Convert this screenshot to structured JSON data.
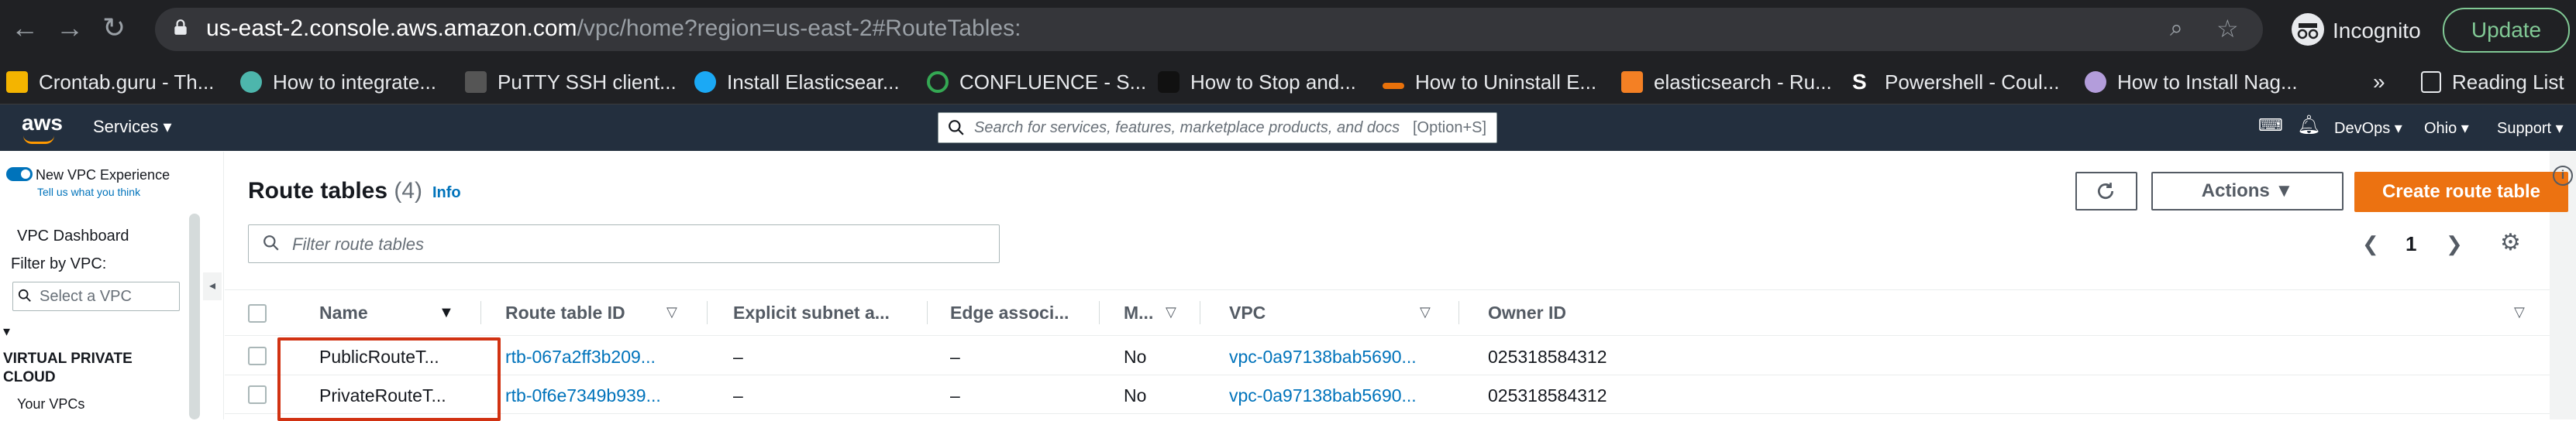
{
  "browser": {
    "url_host": "us-east-2.console.aws.amazon.com",
    "url_path": "/vpc/home?region=us-east-2#RouteTables:",
    "incognito_label": "Incognito",
    "update_label": "Update",
    "reading_list_label": "Reading List",
    "overflow_label": "»",
    "bookmarks": [
      {
        "label": "Crontab.guru - Th...",
        "color": "#f4b400"
      },
      {
        "label": "How to integrate...",
        "color": "#4db6ac"
      },
      {
        "label": "PuTTY SSH client...",
        "color": "#555555"
      },
      {
        "label": "Install Elasticsear...",
        "color": "#1ba9f5"
      },
      {
        "label": "CONFLUENCE - S...",
        "color": "#34a853"
      },
      {
        "label": "How to Stop and...",
        "color": "#333333"
      },
      {
        "label": "How to Uninstall E...",
        "color": "#e8710a"
      },
      {
        "label": "elasticsearch - Ru...",
        "color": "#f48024"
      },
      {
        "label": "Powershell - Coul...",
        "color": "#ffffff"
      },
      {
        "label": "How to Install Nag...",
        "color": "#b39ddb"
      }
    ]
  },
  "aws": {
    "logo": "aws",
    "services_label": "Services",
    "search_placeholder": "Search for services, features, marketplace products, and docs",
    "search_shortcut": "[Option+S]",
    "account_label": "DevOps",
    "region_label": "Ohio",
    "support_label": "Support"
  },
  "sidebar": {
    "new_experience_label": "New VPC Experience",
    "tell_us_label": "Tell us what you think",
    "dashboard_label": "VPC Dashboard",
    "filter_label": "Filter by VPC:",
    "select_placeholder": "Select a VPC",
    "section_heading": "VIRTUAL PRIVATE CLOUD",
    "your_vpcs_label": "Your VPCs"
  },
  "main": {
    "title": "Route tables",
    "count": "(4)",
    "info_label": "Info",
    "refresh_icon": "refresh-icon",
    "actions_label": "Actions",
    "create_label": "Create route table",
    "filter_placeholder": "Filter route tables",
    "page_number": "1",
    "columns": [
      "Name",
      "Route table ID",
      "Explicit subnet a...",
      "Edge associ...",
      "M...",
      "VPC",
      "Owner ID"
    ],
    "rows": [
      {
        "name": "PublicRouteT...",
        "id": "rtb-067a2ff3b209...",
        "subnet": "–",
        "edge": "–",
        "main": "No",
        "vpc": "vpc-0a97138bab5690...",
        "owner": "025318584312"
      },
      {
        "name": "PrivateRouteT...",
        "id": "rtb-0f6e7349b939...",
        "subnet": "–",
        "edge": "–",
        "main": "No",
        "vpc": "vpc-0a97138bab5690...",
        "owner": "025318584312"
      }
    ]
  }
}
